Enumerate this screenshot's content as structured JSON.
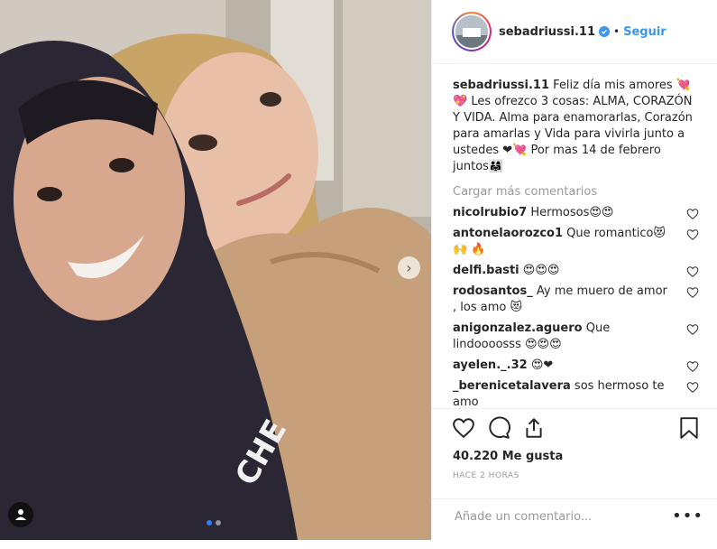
{
  "post": {
    "username": "sebadriussi.11",
    "separator": "•",
    "follow_label": "Seguir"
  },
  "caption": {
    "username": "sebadriussi.11",
    "text": "Feliz día mis amores 💘💖 Les ofrezco 3 cosas: ALMA, CORAZÓN Y VIDA. Alma para enamorarlas, Corazón para amarlas y Vida para vivirla junto a ustedes ❤💘 Por mas 14 de febrero juntos👨‍👩‍👧"
  },
  "load_more_label": "Cargar más comentarios",
  "comments": [
    {
      "user": "nicolrubio7",
      "text": "Hermosos😍😍"
    },
    {
      "user": "antonelaorozco1",
      "text": "Que romantico😻🙌 🔥"
    },
    {
      "user": "delfi.basti",
      "text": "😍😍😍"
    },
    {
      "user": "rodosantos_",
      "text": "Ay me muero de amor , los amo 😻"
    },
    {
      "user": "anigonzalez.aguero",
      "text": "Que lindoooosss 😍😍😍"
    },
    {
      "user": "ayelen._.32",
      "text": "😍❤"
    },
    {
      "user": "_berenicetalavera",
      "text": "sos hermoso te amo"
    }
  ],
  "likes_label": "40.220 Me gusta",
  "time_label": "HACE 2 HORAS",
  "comment_placeholder": "Añade un comentario...",
  "more_label": "•••",
  "icons": {
    "like": "heart-icon",
    "comment": "comment-icon",
    "share": "share-icon",
    "save": "bookmark-icon",
    "next": "chevron-right-icon",
    "tag": "user-tag-icon",
    "verified": "verified-badge-icon"
  },
  "colors": {
    "accent": "#3897f0",
    "text": "#262626",
    "muted": "#999999",
    "border": "#efefef"
  }
}
